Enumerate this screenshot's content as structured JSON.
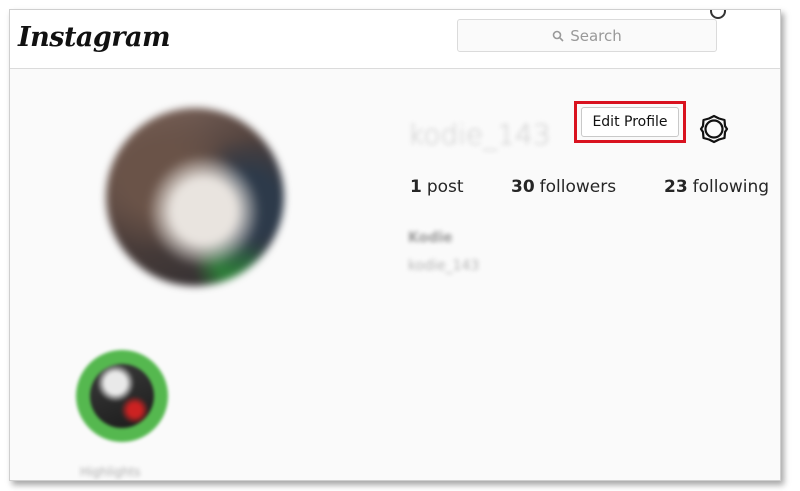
{
  "header": {
    "logo": "Instagram",
    "search_placeholder": "Search"
  },
  "profile": {
    "username": "kodie_143",
    "edit_button_label": "Edit Profile",
    "stats": {
      "posts_count": "1",
      "posts_label": "post",
      "followers_count": "30",
      "followers_label": "followers",
      "following_count": "23",
      "following_label": "following"
    },
    "bio_name": "Kodie",
    "bio_handle": "kodie_143"
  },
  "highlights": [
    {
      "label": "Highlights"
    }
  ],
  "colors": {
    "annotation_box": "#d9121f",
    "highlight_ring": "#55b84f"
  }
}
